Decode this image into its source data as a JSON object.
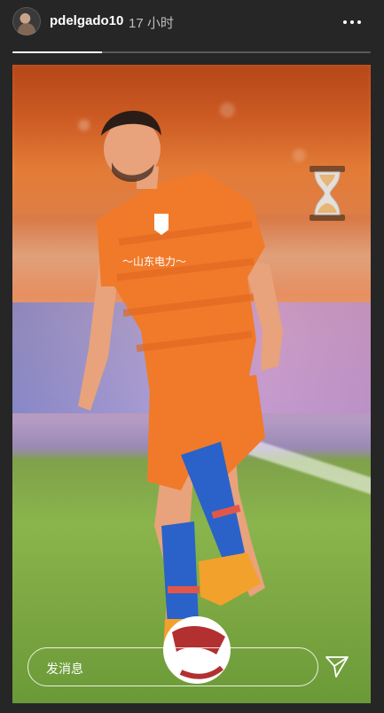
{
  "header": {
    "username": "pdelgado10",
    "time_ago": "17 小时",
    "more_icon": "more-horizontal-icon"
  },
  "story": {
    "progress": 0.25,
    "sticker_icon": "hourglass-icon",
    "reply": {
      "placeholder": "发消息"
    },
    "send_icon": "send-icon"
  },
  "colors": {
    "background": "#262626",
    "jersey": "#f07a2a",
    "socks": "#2a62c9"
  }
}
